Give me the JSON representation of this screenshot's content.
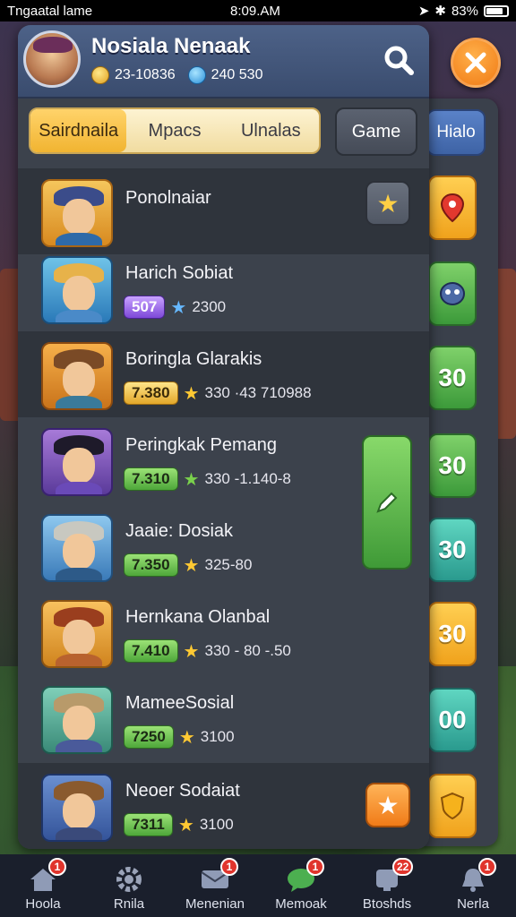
{
  "status_bar": {
    "carrier": "Tngaatal lame",
    "time": "8:09.AM",
    "battery": "83%",
    "battery_level": 0.83
  },
  "header": {
    "player_name": "Nosiala Nenaak",
    "coins": "23-10836",
    "gems": "240 530"
  },
  "tabs": [
    {
      "label": "Sairdnaila",
      "active": true
    },
    {
      "label": "Mpacs",
      "active": false
    },
    {
      "label": "Ulnalas",
      "active": false
    }
  ],
  "game_button": "Game",
  "back_panel": {
    "tab_label": "Hialo",
    "buttons": [
      "30",
      "30",
      "30",
      "30",
      "00"
    ]
  },
  "list": [
    {
      "name": "Ponolnaiar",
      "level": "",
      "stats": "",
      "action": "star"
    },
    {
      "name": "Harich Sobiat",
      "level": "507",
      "stats": "2300",
      "action": ""
    },
    {
      "name": "Boringla Glarakis",
      "level": "7.380",
      "stats": "330 ·43 710988",
      "action": ""
    },
    {
      "name": "Peringkak Pemang",
      "level": "7.310",
      "stats": "330 -1.140-8",
      "action": "edit"
    },
    {
      "name": "Jaaie: Dosiak",
      "level": "7.350",
      "stats": "325-80",
      "action": ""
    },
    {
      "name": "Hernkana Olanbal",
      "level": "7.410",
      "stats": "330 - 80 -.50",
      "action": ""
    },
    {
      "name": "MameeSosial",
      "level": "7250",
      "stats": "3100",
      "action": ""
    },
    {
      "name": "Neoer Sodaiat",
      "level": "7311",
      "stats": "3100",
      "action": "star"
    }
  ],
  "nav": [
    {
      "label": "Hoola",
      "badge": "1",
      "icon": "house-icon"
    },
    {
      "label": "Rnila",
      "badge": "",
      "icon": "gear-icon"
    },
    {
      "label": "Menenian",
      "badge": "1",
      "icon": "mail-icon"
    },
    {
      "label": "Memoak",
      "badge": "1",
      "icon": "chat-icon"
    },
    {
      "label": "Btoshds",
      "badge": "22",
      "icon": "trophy-icon"
    },
    {
      "label": "Nerla",
      "badge": "1",
      "icon": "bell-icon"
    }
  ],
  "colors": {
    "panel": "#3c424c",
    "header": "#4d6288",
    "accent_orange": "#f07a14",
    "accent_green": "#4ea73a",
    "tab_gold": "#f1b431"
  }
}
